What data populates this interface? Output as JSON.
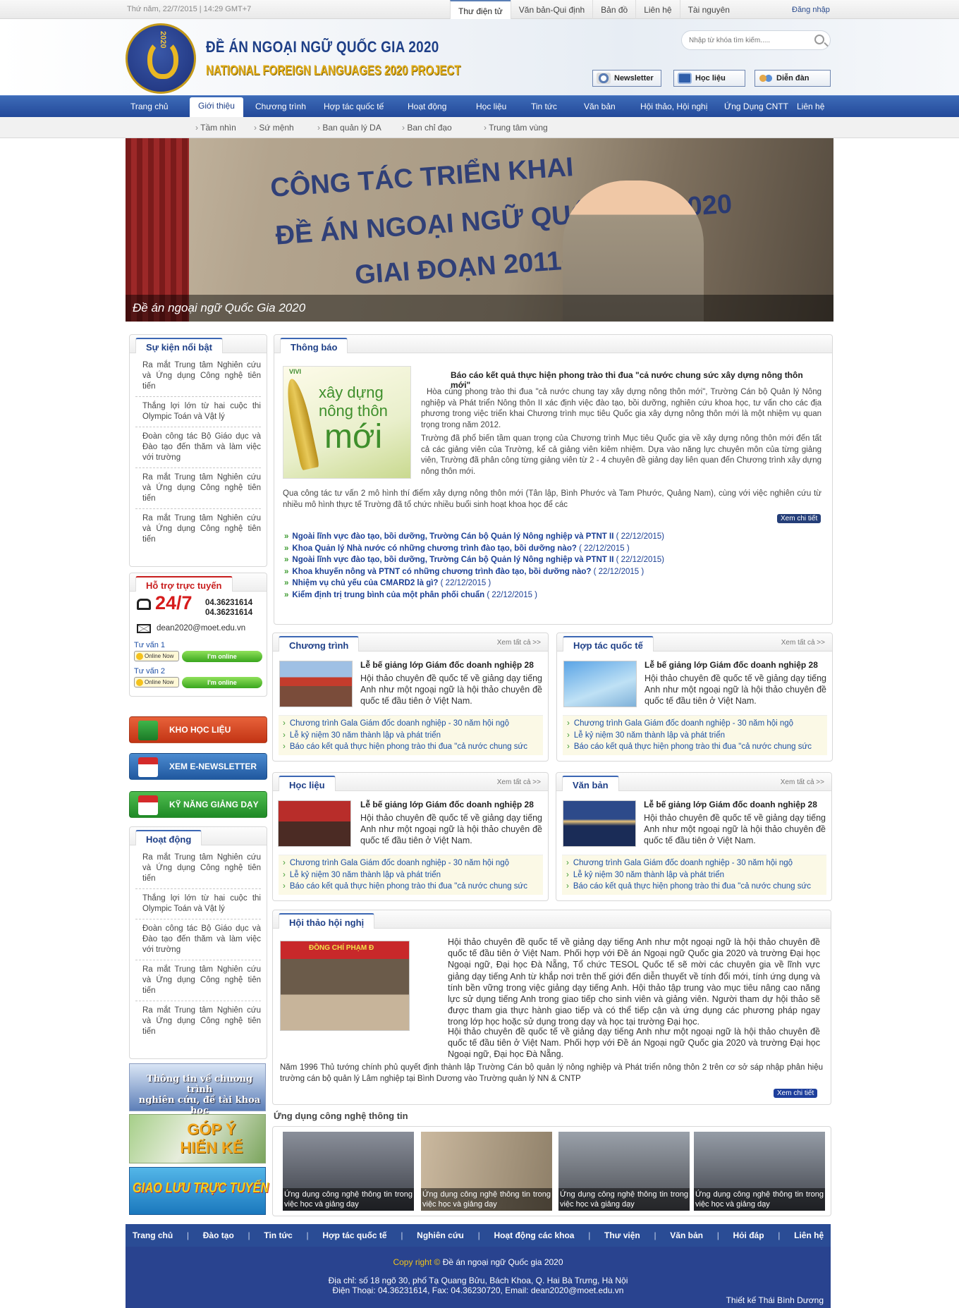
{
  "topbar": {
    "date": "Thứ năm, 22/7/2015 | 14:29 GMT+7",
    "tabs": [
      "Thư điện tử",
      "Văn bản-Qui định",
      "Bản đồ",
      "Liên hệ",
      "Tài nguyên"
    ],
    "login": "Đăng nhập"
  },
  "header": {
    "title_vn": "ĐỀ ÁN NGOẠI NGỮ QUỐC GIA 2020",
    "title_en": "NATIONAL FOREIGN LANGUAGES 2020 PROJECT",
    "logo_text": "2020",
    "search_placeholder": "Nhập từ khóa tìm kiếm.....",
    "buttons": [
      "Newsletter",
      "Học liệu",
      "Diễn đàn"
    ]
  },
  "nav": {
    "items": [
      "Trang chủ",
      "Giới thiệu",
      "Chương trình",
      "Hợp tác quốc tế",
      "Hoạt động",
      "Học liệu",
      "Tin tức",
      "Văn bản",
      "Hội thảo, Hội nghị",
      "Ứng Dụng CNTT",
      "Liên hệ"
    ],
    "active": "Giới thiệu",
    "sub": [
      "Tầm nhìn",
      "Sứ mệnh",
      "Ban quản lý DA",
      "Ban chỉ đạo",
      "Trung tâm vùng"
    ]
  },
  "banner": {
    "line1": "CÔNG TÁC TRIỂN KHAI",
    "line2": "ĐỀ ÁN NGOẠI NGỮ QUỐC GIA 2020",
    "line3": "GIAI ĐOẠN 2011-2013",
    "caption": "Đề án ngoại ngữ Quốc Gia 2020"
  },
  "events": {
    "title": "Sự kiện nổi bật",
    "items": [
      "Ra mắt Trung tâm Nghiên cứu và Ứng dụng Công nghệ tiên tiến",
      "Thắng lợi lớn từ hai cuộc thi Olympic Toán và Vật lý",
      "Đoàn công tác Bộ Giáo dục và Đào tạo đến thăm và làm việc với trường",
      "Ra mắt Trung tâm Nghiên cứu và Ứng dụng Công nghệ tiên tiến",
      "Ra mắt Trung tâm Nghiên cứu và Ứng dụng Công nghệ tiên tiến"
    ]
  },
  "support": {
    "title": "Hỗ trợ trực tuyến",
    "hotline": "24/7",
    "phone1": "04.36231614",
    "phone2": "04.36231614",
    "email": "dean2020@moet.edu.vn",
    "advisors": [
      {
        "label": "Tư vấn 1",
        "status": "Online Now",
        "badge": "I'm online"
      },
      {
        "label": "Tư vấn 2",
        "status": "Online Now",
        "badge": "I'm online"
      }
    ]
  },
  "side_buttons": [
    "KHO HỌC LIỆU",
    "XEM E-NEWSLETTER",
    "KỸ NĂNG GIẢNG DẠY"
  ],
  "side_button_colors": [
    "#d8421e",
    "#2e6fb4",
    "#2e9e35"
  ],
  "activities": {
    "title": "Hoạt động",
    "items": [
      "Ra mắt Trung tâm Nghiên cứu và Ứng dụng Công nghệ tiên tiến",
      "Thắng lợi lớn từ hai cuộc thi Olympic Toán và Vật lý",
      "Đoàn công tác Bộ Giáo dục và Đào tạo đến thăm và làm việc với trường",
      "Ra mắt Trung tâm Nghiên cứu và Ứng dụng Công nghệ tiên tiến",
      "Ra mắt Trung tâm Nghiên cứu và Ứng dụng Công nghệ tiên tiến"
    ]
  },
  "promo_banners": [
    {
      "line1": "Thông tin về chương trình",
      "line2": "nghiên cứu, đề tài khoa học"
    },
    {
      "line1": "GÓP Ý",
      "line2": "HIẾN KẾ"
    },
    {
      "line1": "GIAO LƯU TRỰC TUYẾN"
    }
  ],
  "notice": {
    "tab": "Thông báo",
    "img_brand": "VIVI",
    "img_line1": "xây dựng",
    "img_line2": "nông thôn",
    "img_line3": "mới",
    "headline": "Báo cáo kết quả thực hiện phong trào thi đua \"cả nước chung sức xây dựng nông thôn mới\"",
    "body1": "Hòa cùng phong trào thi đua \"cả nước chung tay xây dựng nông thôn mới\", Trường Cán bộ Quản lý Nông nghiệp và Phát triển Nông thôn II xác định việc đào tạo, bồi dưỡng, nghiên cứu khoa học, tư vấn cho các địa phương trong việc triển khai Chương trình mục tiêu Quốc gia xây dựng nông thôn mới là một nhiệm vụ quan trọng trong năm 2012.",
    "body2": "Trường đã phổ biến tầm quan trọng của Chương trình Mục tiêu Quốc gia về xây dựng nông thôn mới đến tất cả các giảng viên của Trường, kể cả giảng viên kiêm nhiệm. Dựa vào năng lực chuyên môn của từng giảng viên, Trường đã phân công từng giảng viên từ 2 - 4 chuyên đề giảng dạy liên quan đến Chương trình xây dựng nông thôn mới.",
    "body3": "Qua công tác tư vấn 2 mô hình thí điểm xây dựng nông thôn mới (Tân lập, Bình Phước và Tam Phước, Quảng Nam), cùng với việc nghiên cứu từ nhiều mô hình thực tế Trường đã tổ chức nhiều buổi sinh hoạt khoa học để các",
    "more": "Xem chi tiết",
    "links": [
      {
        "t": "Ngoài lĩnh vực đào tạo, bồi dưỡng, Trường Cán bộ Quản lý Nông nghiệp và PTNT II",
        "d": "( 22/12/2015)"
      },
      {
        "t": "Khoa Quản lý Nhà nước có những chương trình đào tạo, bồi dưỡng nào?",
        "d": "( 22/12/2015 )"
      },
      {
        "t": "Ngoài lĩnh vực đào tạo, bồi dưỡng, Trường Cán bộ Quản lý Nông nghiệp và PTNT II",
        "d": "( 22/12/2015)"
      },
      {
        "t": "Khoa khuyến nông và PTNT có những chương trình đào tạo, bồi dưỡng nào?",
        "d": "( 22/12/2015 )"
      },
      {
        "t": "Nhiệm vụ chủ yếu của CMARD2 là gì?",
        "d": "( 22/12/2015 )"
      },
      {
        "t": "Kiểm định trị trung bình của một phân phối chuẩn",
        "d": "( 22/12/2015 )"
      }
    ]
  },
  "cats": [
    {
      "tab": "Chương trình",
      "more": "Xem tất cả >>",
      "title": "Lễ bế giảng lớp Giám đốc doanh nghiệp 28",
      "desc": "Hội thảo chuyên đề quốc tế về giảng dạy tiếng Anh như một ngoại ngữ là hội thảo chuyên đề quốc tế đầu tiên ở Việt Nam.",
      "links": [
        "Chương trình Gala Giám đốc doanh nghiệp - 30 năm hội ngộ",
        "Lễ kỷ niệm 30 năm thành lập và phát triển",
        "Báo cáo kết quả thực hiện phong trào thi đua \"cả nước chung sức"
      ]
    },
    {
      "tab": "Hợp tác quốc tế",
      "more": "Xem tất cả >>",
      "title": "Lễ bế giảng lớp Giám đốc doanh nghiệp 28",
      "desc": "Hội thảo chuyên đề quốc tế về giảng dạy tiếng Anh như một ngoại ngữ là hội thảo chuyên đề quốc tế đầu tiên ở Việt Nam.",
      "links": [
        "Chương trình Gala Giám đốc doanh nghiệp - 30 năm hội ngộ",
        "Lễ kỷ niệm 30 năm thành lập và phát triển",
        "Báo cáo kết quả thực hiện phong trào thi đua \"cả nước chung sức"
      ]
    },
    {
      "tab": "Học liệu",
      "more": "Xem tất cả >>",
      "title": "Lễ bế giảng lớp Giám đốc doanh nghiệp 28",
      "desc": "Hội thảo chuyên đề quốc tế về giảng dạy tiếng Anh như một ngoại ngữ là hội thảo chuyên đề quốc tế đầu tiên ở Việt Nam.",
      "links": [
        "Chương trình Gala Giám đốc doanh nghiệp - 30 năm hội ngộ",
        "Lễ kỷ niệm 30 năm thành lập và phát triển",
        "Báo cáo kết quả thực hiện phong trào thi đua \"cả nước chung sức"
      ]
    },
    {
      "tab": "Văn bản",
      "more": "Xem tất cả >>",
      "title": "Lễ bế giảng lớp Giám đốc doanh nghiệp 28",
      "desc": "Hội thảo chuyên đề quốc tế về giảng dạy tiếng Anh như một ngoại ngữ là hội thảo chuyên đề quốc tế đầu tiên ở Việt Nam.",
      "links": [
        "Chương trình Gala Giám đốc doanh nghiệp - 30 năm hội ngộ",
        "Lễ kỷ niệm 30 năm thành lập và phát triển",
        "Báo cáo kết quả thực hiện phong trào thi đua \"cả nước chung sức"
      ]
    }
  ],
  "seminar": {
    "tab": "Hội thảo hội nghị",
    "img_text": "ĐỒNG CHÍ PHẠM Đ",
    "body1": "Hội thảo chuyên đề quốc tế về giảng dạy tiếng Anh như một ngoại ngữ là hội thảo chuyên đề quốc tế đầu tiên ở Việt Nam. Phối hợp với Đề án Ngoại ngữ Quốc gia 2020 và trường Đại học Ngoại ngữ, Đại học Đà Nẵng, Tổ chức TESOL Quốc tế sẽ mời các chuyên gia về lĩnh vực giảng dạy tiếng Anh từ khắp nơi trên thế giới đến diễn thuyết về tính đổi mới, tính ứng dụng và tính bền vững trong việc giảng dạy tiếng Anh. Hội thảo tập trung vào mục tiêu nâng cao năng lực sử dụng tiếng Anh trong giao tiếp cho sinh viên và giảng viên. Người tham dự hội thảo sẽ được tham gia thực hành giao tiếp và có thể tiếp cận và ứng dụng các phương pháp ngay trong lớp học hoặc sử dụng trong dạy và học tại trường Đại học.",
    "body2": "Hội thảo chuyên đề quốc tế về giảng dạy tiếng Anh như một ngoại ngữ là hội thảo chuyên đề quốc tế đầu tiên ở Việt Nam. Phối hợp với Đề án Ngoại ngữ Quốc gia 2020 và trường Đại học Ngoại ngữ, Đại học Đà Nẵng.",
    "body3": "Năm 1996 Thủ tướng chính phủ quyết định thành lập Trường Cán bộ quản lý nông nghiệp và Phát triển nông thôn 2 trên cơ sở sáp nhập phân hiệu trường cán bộ quản lý Lâm nghiệp tại Bình Dương vào Trường quản lý NN & CNTP",
    "more": "Xem chi tiết"
  },
  "it": {
    "title": "Ứng dụng công nghệ thông tin",
    "items": [
      "Ứng dụng công nghệ thông tin trong việc học và giảng dạy",
      "Ứng dụng công nghệ thông tin trong việc học và giảng dạy",
      "Ứng dụng công nghệ thông tin trong việc học và giảng dạy",
      "Ứng dụng công nghệ thông tin trong việc học và giảng dạy"
    ]
  },
  "footer": {
    "nav": [
      "Trang chủ",
      "Đào tạo",
      "Tin tức",
      "Hợp tác quốc tế",
      "Nghiên cứu",
      "Hoạt động các khoa",
      "Thư viện",
      "Văn bản",
      "Hỏi đáp",
      "Liên hệ"
    ],
    "copy_label": "Copy right ©",
    "copy_text": "Đề án ngoại ngữ Quốc gia 2020",
    "address": "Địa chỉ: số 18 ngõ 30, phố Tạ Quang Bửu, Bách Khoa, Q. Hai Bà Trưng, Hà Nội",
    "contact": "Điện Thoại: 04.36231614, Fax: 04.36230720, Email: dean2020@moet.edu.vn",
    "design": "Thiết kế Thái Bình Dương"
  }
}
